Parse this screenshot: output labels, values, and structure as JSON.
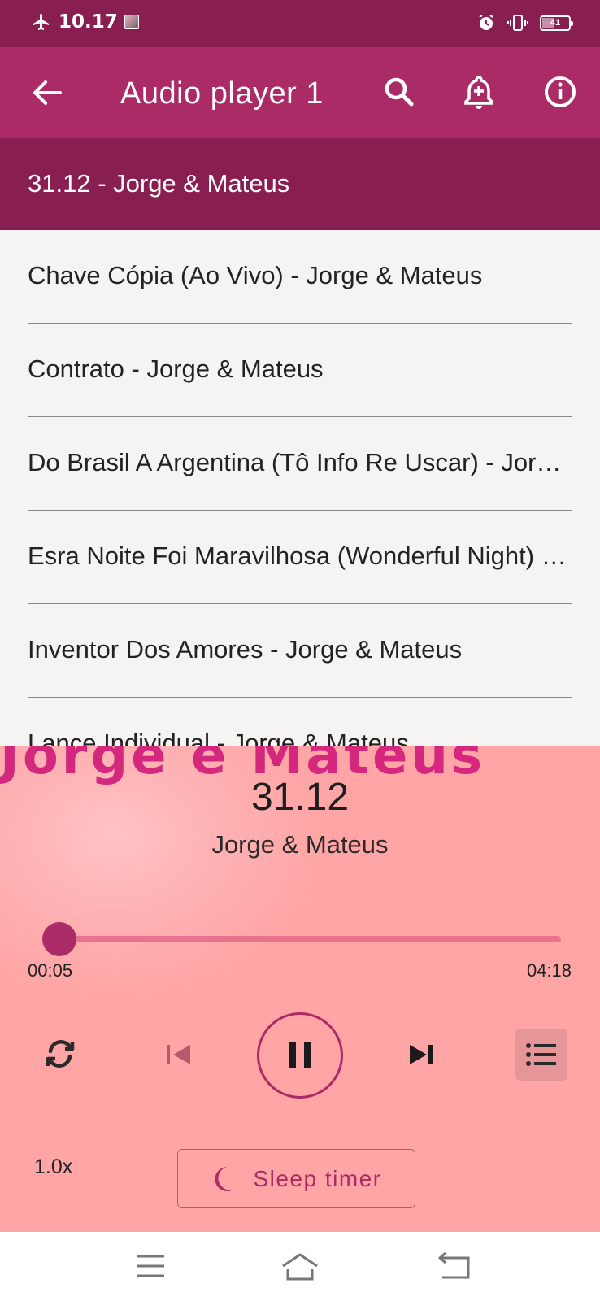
{
  "status_bar": {
    "time": "10.17",
    "battery": "41",
    "icons": [
      "airplane-icon",
      "photo-thumbnail-icon",
      "alarm-icon",
      "vibrate-icon",
      "battery-icon"
    ]
  },
  "app_bar": {
    "title": "Audio player 1",
    "icons": [
      "back-arrow-icon",
      "search-icon",
      "add-alarm-icon",
      "info-icon"
    ]
  },
  "now_playing_row": {
    "label": "31.12 - Jorge & Mateus"
  },
  "playlist": {
    "items": [
      "Chave Cópia (Ao Vivo) - Jorge & Mateus",
      "Contrato - Jorge & Mateus",
      "Do Brasil A Argentina (Tô Info Re Uscar) - Jorge & Mateus",
      "Esra Noite Foi Maravilhosa (Wonderful Night) - Jorge & Mateus",
      "Inventor Dos Amores - Jorge & Mateus",
      "Lance Individual - Jorge & Mateus"
    ]
  },
  "player": {
    "song_title": "31.12",
    "artist": "Jorge & Mateus",
    "artwork_text": "Jorge e Mateus",
    "current_time": "00:05",
    "total_time": "04:18",
    "progress_fraction": 0.02,
    "speed": "1.0x",
    "sleep_timer_label": "Sleep timer",
    "controls": [
      "repeat-icon",
      "skip-previous-icon",
      "pause-icon",
      "skip-next-icon",
      "queue-list-icon"
    ]
  },
  "nav_bar": {
    "icons": [
      "menu-icon",
      "home-icon",
      "back-icon"
    ]
  },
  "colors": {
    "status_bar": "#891f51",
    "app_bar": "#ab2b66",
    "accent": "#ab2b66",
    "player_bg": "#ffa5a5",
    "list_bg": "#f5f4f2"
  }
}
